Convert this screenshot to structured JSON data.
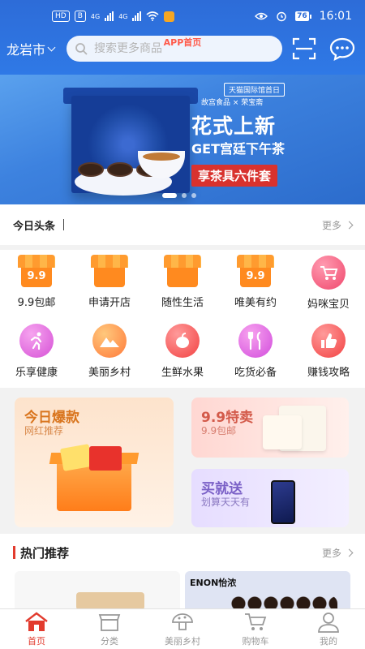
{
  "status_bar": {
    "network_badges": [
      "HD",
      "B"
    ],
    "signal_labels": [
      "4G",
      "4G"
    ],
    "battery": "76",
    "time": "16:01"
  },
  "header": {
    "app_label": "APP首页",
    "city": "龙岩市",
    "search_placeholder": "搜索更多商品"
  },
  "banner": {
    "brand_tag": "天猫国际馆首日",
    "brand_sub": "故宫食品 × 荣宝斋",
    "headline": "花式上新",
    "subhead": "GET宫廷下午茶",
    "cta": "享茶具六件套",
    "active_slide": 1,
    "slide_count": 3
  },
  "headlines": {
    "title": "今日头条",
    "more": "更多"
  },
  "categories": [
    {
      "label": "9.9包邮",
      "icon": "shop-99-icon"
    },
    {
      "label": "申请开店",
      "icon": "shop-apply-icon"
    },
    {
      "label": "随性生活",
      "icon": "shop-life-icon"
    },
    {
      "label": "唯美有约",
      "icon": "shop-99b-icon"
    },
    {
      "label": "妈咪宝贝",
      "icon": "stroller-icon"
    },
    {
      "label": "乐享健康",
      "icon": "runner-icon"
    },
    {
      "label": "美丽乡村",
      "icon": "mountain-icon"
    },
    {
      "label": "生鲜水果",
      "icon": "fruit-icon"
    },
    {
      "label": "吃货必备",
      "icon": "cutlery-icon"
    },
    {
      "label": "赚钱攻略",
      "icon": "thumbs-up-icon"
    }
  ],
  "shop_icon_text": "9.9",
  "promos": {
    "card1": {
      "title": "今日爆款",
      "subtitle": "网红推荐"
    },
    "card2": {
      "title": "9.9特卖",
      "subtitle": "9.9包邮"
    },
    "card3": {
      "title": "买就送",
      "subtitle": "划算天天有"
    }
  },
  "hot": {
    "title": "热门推荐",
    "more": "更多",
    "item2_brand": "ENON怡浓"
  },
  "tabbar": {
    "tabs": [
      {
        "label": "首页",
        "active": true
      },
      {
        "label": "分类",
        "active": false
      },
      {
        "label": "美丽乡村",
        "active": false
      },
      {
        "label": "购物车",
        "active": false
      },
      {
        "label": "我的",
        "active": false
      }
    ]
  },
  "colors": {
    "header_blue": "#2f79e6",
    "accent_red": "#e23b2e",
    "app_label_red": "#ff5a4a"
  }
}
